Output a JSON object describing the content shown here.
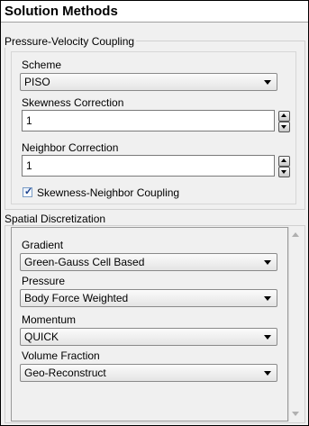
{
  "panel": {
    "title": "Solution Methods"
  },
  "pressure_velocity": {
    "group_label": "Pressure-Velocity Coupling",
    "scheme_label": "Scheme",
    "scheme_value": "PISO",
    "skewness_label": "Skewness Correction",
    "skewness_value": "1",
    "neighbor_label": "Neighbor Correction",
    "neighbor_value": "1",
    "coupling_checkbox_label": "Skewness-Neighbor Coupling",
    "coupling_checked": true
  },
  "spatial": {
    "group_label": "Spatial Discretization",
    "gradient_label": "Gradient",
    "gradient_value": "Green-Gauss Cell Based",
    "pressure_label": "Pressure",
    "pressure_value": "Body Force Weighted",
    "momentum_label": "Momentum",
    "momentum_value": "QUICK",
    "volume_fraction_label": "Volume Fraction",
    "volume_fraction_value": "Geo-Reconstruct"
  },
  "icons": {
    "combo_arrow": "chevron-down-icon",
    "spin_up": "spin-up-icon",
    "spin_down": "spin-down-icon",
    "check": "checkmark-icon"
  }
}
